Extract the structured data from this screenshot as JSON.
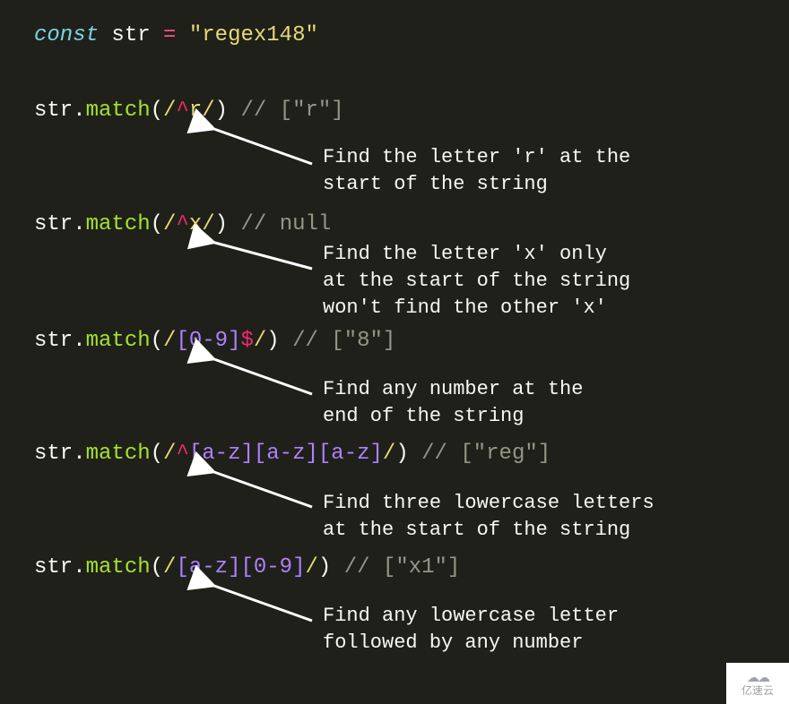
{
  "decl": {
    "keyword": "const",
    "var": "str",
    "op": "=",
    "value": "\"regex148\""
  },
  "examples": [
    {
      "spans": [
        {
          "class": "s-plain",
          "text": "str"
        },
        {
          "class": "s-punc",
          "text": "."
        },
        {
          "class": "s-method",
          "text": "match"
        },
        {
          "class": "s-punc",
          "text": "("
        },
        {
          "class": "s-regex-d",
          "text": "/"
        },
        {
          "class": "s-regex-anc",
          "text": "^"
        },
        {
          "class": "s-regex-lit",
          "text": "r"
        },
        {
          "class": "s-regex-d",
          "text": "/"
        },
        {
          "class": "s-punc",
          "text": ") "
        },
        {
          "class": "s-comment",
          "text": "// [\"r\"]"
        }
      ],
      "desc": "Find the letter 'r' at the\nstart of the string"
    },
    {
      "spans": [
        {
          "class": "s-plain",
          "text": "str"
        },
        {
          "class": "s-punc",
          "text": "."
        },
        {
          "class": "s-method",
          "text": "match"
        },
        {
          "class": "s-punc",
          "text": "("
        },
        {
          "class": "s-regex-d",
          "text": "/"
        },
        {
          "class": "s-regex-anc",
          "text": "^"
        },
        {
          "class": "s-regex-lit",
          "text": "x"
        },
        {
          "class": "s-regex-d",
          "text": "/"
        },
        {
          "class": "s-punc",
          "text": ") "
        },
        {
          "class": "s-comment",
          "text": "// null"
        }
      ],
      "desc": "Find the letter 'x' only\nat the start of the string\nwon't find the other 'x'"
    },
    {
      "spans": [
        {
          "class": "s-plain",
          "text": "str"
        },
        {
          "class": "s-punc",
          "text": "."
        },
        {
          "class": "s-method",
          "text": "match"
        },
        {
          "class": "s-punc",
          "text": "("
        },
        {
          "class": "s-regex-d",
          "text": "/"
        },
        {
          "class": "s-regex-cls",
          "text": "[0-9]"
        },
        {
          "class": "s-regex-anc",
          "text": "$"
        },
        {
          "class": "s-regex-d",
          "text": "/"
        },
        {
          "class": "s-punc",
          "text": ") "
        },
        {
          "class": "s-comment",
          "text": "// [\"8\"]"
        }
      ],
      "desc": "Find any number at the\nend of the string"
    },
    {
      "spans": [
        {
          "class": "s-plain",
          "text": "str"
        },
        {
          "class": "s-punc",
          "text": "."
        },
        {
          "class": "s-method",
          "text": "match"
        },
        {
          "class": "s-punc",
          "text": "("
        },
        {
          "class": "s-regex-d",
          "text": "/"
        },
        {
          "class": "s-regex-anc",
          "text": "^"
        },
        {
          "class": "s-regex-cls",
          "text": "[a-z][a-z][a-z]"
        },
        {
          "class": "s-regex-d",
          "text": "/"
        },
        {
          "class": "s-punc",
          "text": ") "
        },
        {
          "class": "s-comment",
          "text": "// [\"reg\"]"
        }
      ],
      "desc": "Find three lowercase letters\nat the start of the string"
    },
    {
      "spans": [
        {
          "class": "s-plain",
          "text": "str"
        },
        {
          "class": "s-punc",
          "text": "."
        },
        {
          "class": "s-method",
          "text": "match"
        },
        {
          "class": "s-punc",
          "text": "("
        },
        {
          "class": "s-regex-d",
          "text": "/"
        },
        {
          "class": "s-regex-cls",
          "text": "[a-z][0-9]"
        },
        {
          "class": "s-regex-d",
          "text": "/"
        },
        {
          "class": "s-punc",
          "text": ") "
        },
        {
          "class": "s-comment",
          "text": "// [\"x1\"]"
        }
      ],
      "desc": "Find any lowercase letter\nfollowed by any number"
    }
  ],
  "watermark": "亿速云"
}
